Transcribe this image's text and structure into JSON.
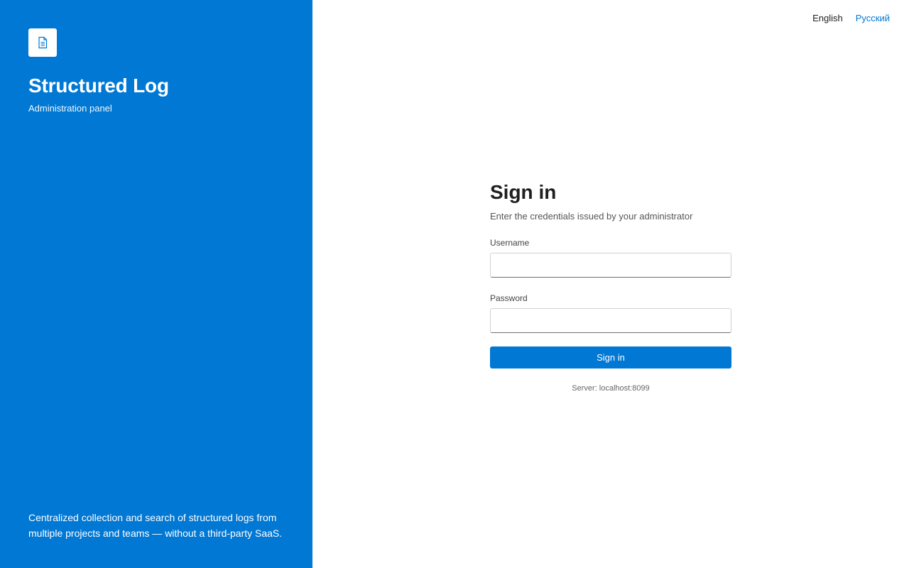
{
  "brand": {
    "logo_icon": "document-icon",
    "title": "Structured Log",
    "subtitle": "Administration panel",
    "description": "Centralized collection and search of structured logs from multiple projects and teams — without a third-party SaaS."
  },
  "language": {
    "options": [
      {
        "label": "English",
        "active": true
      },
      {
        "label": "Русский",
        "active": false
      }
    ]
  },
  "signin": {
    "title": "Sign in",
    "hint": "Enter the credentials issued by your administrator",
    "username_label": "Username",
    "username_value": "",
    "password_label": "Password",
    "password_value": "",
    "button_label": "Sign in",
    "server_info": "Server: localhost:8099"
  },
  "colors": {
    "accent": "#0078d4",
    "link": "#0078d4",
    "background": "#ffffff"
  }
}
